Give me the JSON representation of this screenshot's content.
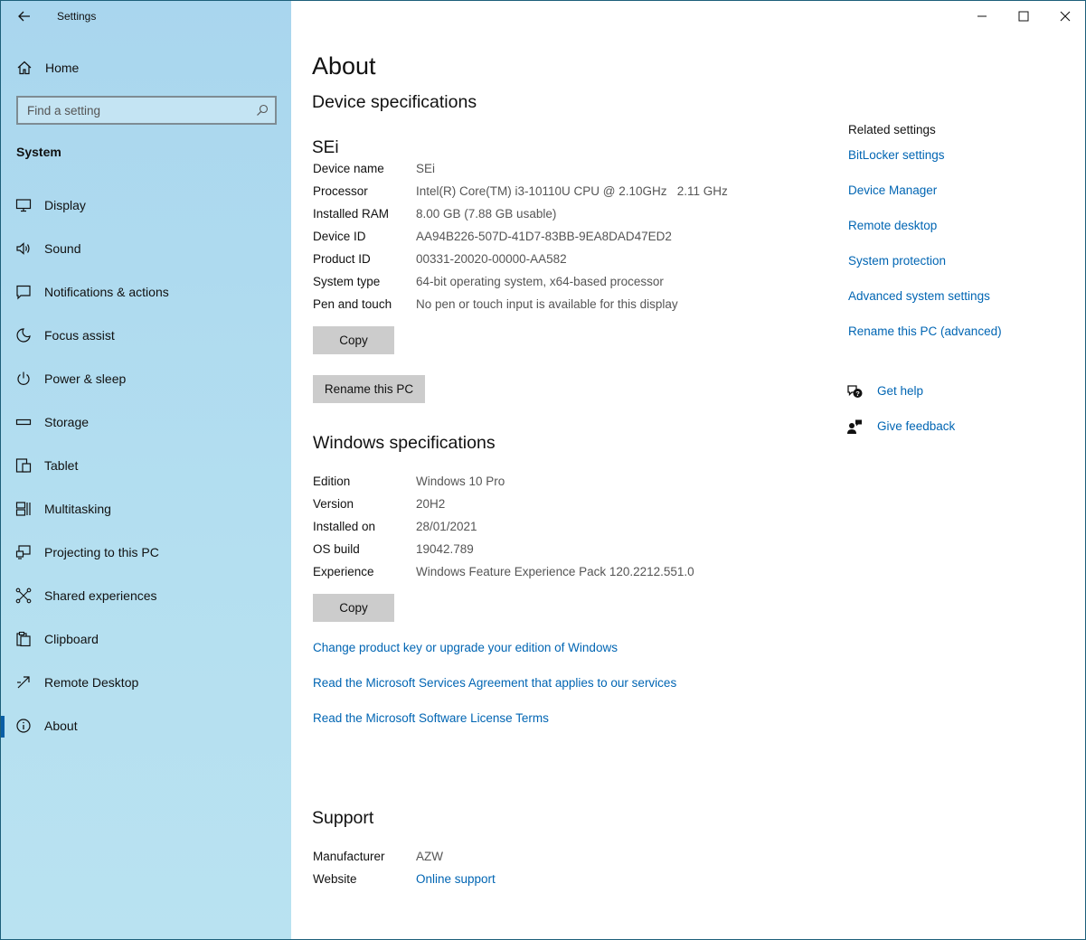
{
  "window": {
    "title": "Settings",
    "back_icon": "back-arrow-icon"
  },
  "sidebar": {
    "home_label": "Home",
    "search_placeholder": "Find a setting",
    "section_title": "System",
    "items": [
      {
        "label": "Display",
        "icon": "display-icon"
      },
      {
        "label": "Sound",
        "icon": "sound-icon"
      },
      {
        "label": "Notifications & actions",
        "icon": "notifications-icon"
      },
      {
        "label": "Focus assist",
        "icon": "moon-icon"
      },
      {
        "label": "Power & sleep",
        "icon": "power-icon"
      },
      {
        "label": "Storage",
        "icon": "storage-icon"
      },
      {
        "label": "Tablet",
        "icon": "tablet-icon"
      },
      {
        "label": "Multitasking",
        "icon": "multitasking-icon"
      },
      {
        "label": "Projecting to this PC",
        "icon": "projecting-icon"
      },
      {
        "label": "Shared experiences",
        "icon": "shared-experiences-icon"
      },
      {
        "label": "Clipboard",
        "icon": "clipboard-icon"
      },
      {
        "label": "Remote Desktop",
        "icon": "remote-desktop-icon"
      },
      {
        "label": "About",
        "icon": "info-icon",
        "active": true
      }
    ]
  },
  "main": {
    "title": "About",
    "device_specs_heading": "Device specifications",
    "device_name_heading": "SEi",
    "device_specs": [
      {
        "key": "Device name",
        "value": "SEi"
      },
      {
        "key": "Processor",
        "value": "Intel(R) Core(TM) i3-10110U CPU @ 2.10GHz   2.11 GHz"
      },
      {
        "key": "Installed RAM",
        "value": "8.00 GB (7.88 GB usable)"
      },
      {
        "key": "Device ID",
        "value": "AA94B226-507D-41D7-83BB-9EA8DAD47ED2"
      },
      {
        "key": "Product ID",
        "value": "00331-20020-00000-AA582"
      },
      {
        "key": "System type",
        "value": "64-bit operating system, x64-based processor"
      },
      {
        "key": "Pen and touch",
        "value": "No pen or touch input is available for this display"
      }
    ],
    "copy_label": "Copy",
    "rename_label": "Rename this PC",
    "windows_specs_heading": "Windows specifications",
    "windows_specs": [
      {
        "key": "Edition",
        "value": "Windows 10 Pro"
      },
      {
        "key": "Version",
        "value": "20H2"
      },
      {
        "key": "Installed on",
        "value": "28/01/2021"
      },
      {
        "key": "OS build",
        "value": "19042.789"
      },
      {
        "key": "Experience",
        "value": "Windows Feature Experience Pack 120.2212.551.0"
      }
    ],
    "copy2_label": "Copy",
    "links": [
      "Change product key or upgrade your edition of Windows",
      "Read the Microsoft Services Agreement that applies to our services",
      "Read the Microsoft Software License Terms"
    ],
    "support_heading": "Support",
    "support": {
      "manufacturer_key": "Manufacturer",
      "manufacturer_value": "AZW",
      "website_key": "Website",
      "website_value": "Online support"
    }
  },
  "related": {
    "title": "Related settings",
    "links": [
      "BitLocker settings",
      "Device Manager",
      "Remote desktop",
      "System protection",
      "Advanced system settings",
      "Rename this PC (advanced)"
    ],
    "get_help": "Get help",
    "give_feedback": "Give feedback"
  },
  "colors": {
    "sidebar_bg": "#b4dff0",
    "link": "#0065b3",
    "button_bg": "#cccccc",
    "active_indicator": "#0a5ea5"
  }
}
